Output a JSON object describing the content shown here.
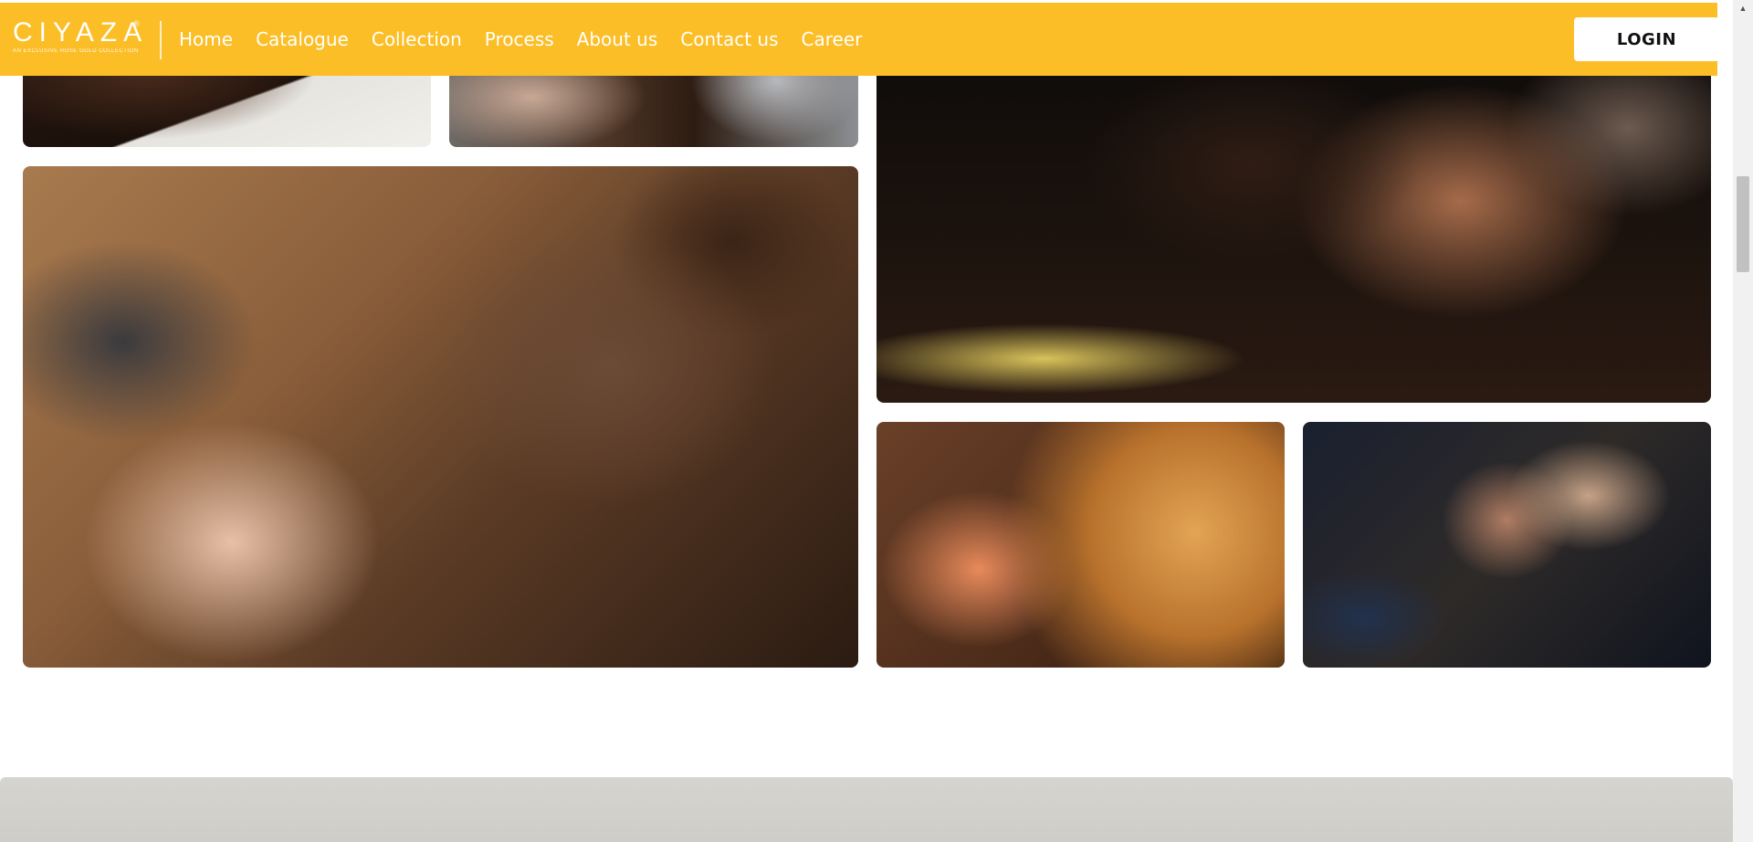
{
  "brand": {
    "name": "CIYAZA",
    "registered": "®",
    "tagline": "AN EXCLUSIVE ROSE GOLD COLLECTION",
    "accent_color": "#fcbe27"
  },
  "nav": {
    "items": [
      {
        "label": "Home"
      },
      {
        "label": "Catalogue"
      },
      {
        "label": "Collection"
      },
      {
        "label": "Process"
      },
      {
        "label": "About us"
      },
      {
        "label": "Contact us"
      },
      {
        "label": "Career"
      }
    ]
  },
  "header": {
    "login_label": "LOGIN"
  },
  "scrollbar": {
    "up_arrow_icon": "triangle-up-icon"
  }
}
